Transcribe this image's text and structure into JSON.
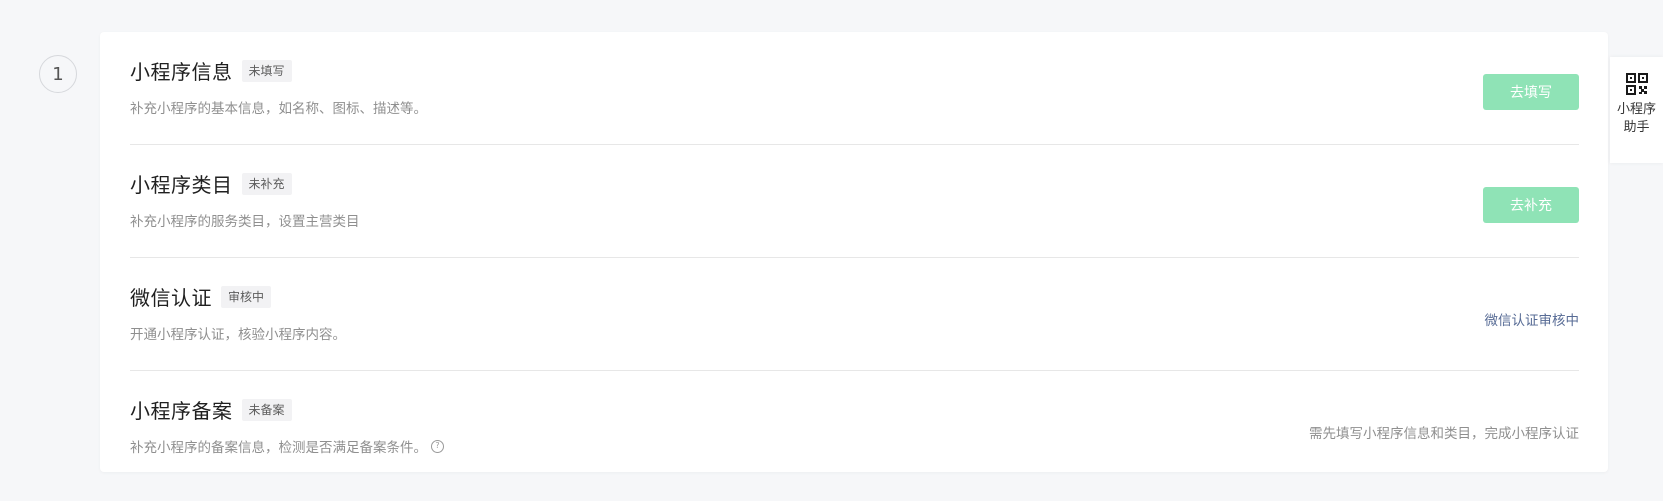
{
  "step": {
    "number": "1"
  },
  "items": [
    {
      "title": "小程序信息",
      "tag": "未填写",
      "description": "补充小程序的基本信息，如名称、图标、描述等。",
      "action_type": "button",
      "action_label": "去填写"
    },
    {
      "title": "小程序类目",
      "tag": "未补充",
      "description": "补充小程序的服务类目，设置主营类目",
      "action_type": "button",
      "action_label": "去补充"
    },
    {
      "title": "微信认证",
      "tag": "审核中",
      "description": "开通小程序认证，核验小程序内容。",
      "action_type": "link",
      "action_label": "微信认证审核中"
    },
    {
      "title": "小程序备案",
      "tag": "未备案",
      "description": "补充小程序的备案信息，检测是否满足备案条件。",
      "help_icon": "question-icon",
      "action_type": "note",
      "action_label": "需先填写小程序信息和类目，完成小程序认证"
    }
  ],
  "helper": {
    "label": "小程序助手",
    "icon": "qr-code-icon"
  },
  "colors": {
    "button_disabled_bg": "#8fe3b6",
    "link": "#576b95",
    "page_bg": "#f6f7f9"
  }
}
